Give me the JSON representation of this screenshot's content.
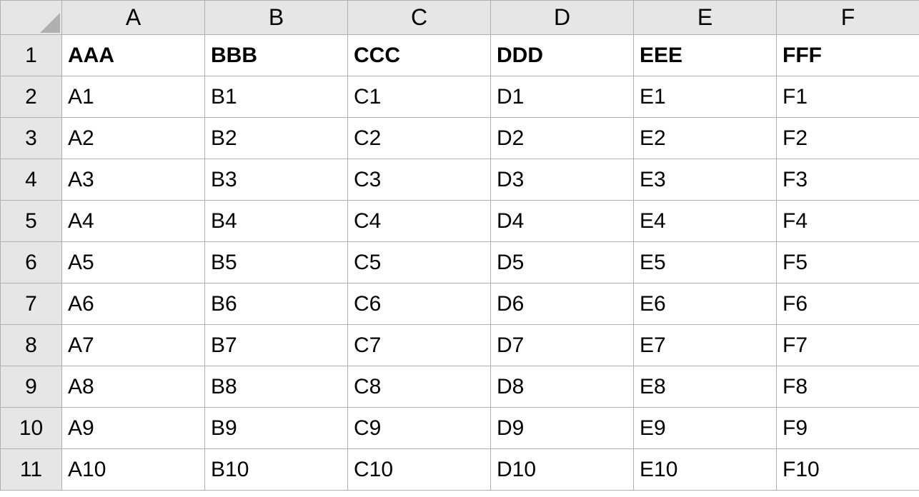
{
  "spreadsheet": {
    "columns": [
      "A",
      "B",
      "C",
      "D",
      "E",
      "F"
    ],
    "row_numbers": [
      "1",
      "2",
      "3",
      "4",
      "5",
      "6",
      "7",
      "8",
      "9",
      "10",
      "11"
    ],
    "rows": [
      {
        "bold": true,
        "cells": [
          "AAA",
          "BBB",
          "CCC",
          "DDD",
          "EEE",
          "FFF"
        ]
      },
      {
        "bold": false,
        "cells": [
          "A1",
          "B1",
          "C1",
          "D1",
          "E1",
          "F1"
        ]
      },
      {
        "bold": false,
        "cells": [
          "A2",
          "B2",
          "C2",
          "D2",
          "E2",
          "F2"
        ]
      },
      {
        "bold": false,
        "cells": [
          "A3",
          "B3",
          "C3",
          "D3",
          "E3",
          "F3"
        ]
      },
      {
        "bold": false,
        "cells": [
          "A4",
          "B4",
          "C4",
          "D4",
          "E4",
          "F4"
        ]
      },
      {
        "bold": false,
        "cells": [
          "A5",
          "B5",
          "C5",
          "D5",
          "E5",
          "F5"
        ]
      },
      {
        "bold": false,
        "cells": [
          "A6",
          "B6",
          "C6",
          "D6",
          "E6",
          "F6"
        ]
      },
      {
        "bold": false,
        "cells": [
          "A7",
          "B7",
          "C7",
          "D7",
          "E7",
          "F7"
        ]
      },
      {
        "bold": false,
        "cells": [
          "A8",
          "B8",
          "C8",
          "D8",
          "E8",
          "F8"
        ]
      },
      {
        "bold": false,
        "cells": [
          "A9",
          "B9",
          "C9",
          "D9",
          "E9",
          "F9"
        ]
      },
      {
        "bold": false,
        "cells": [
          "A10",
          "B10",
          "C10",
          "D10",
          "E10",
          "F10"
        ]
      }
    ]
  }
}
